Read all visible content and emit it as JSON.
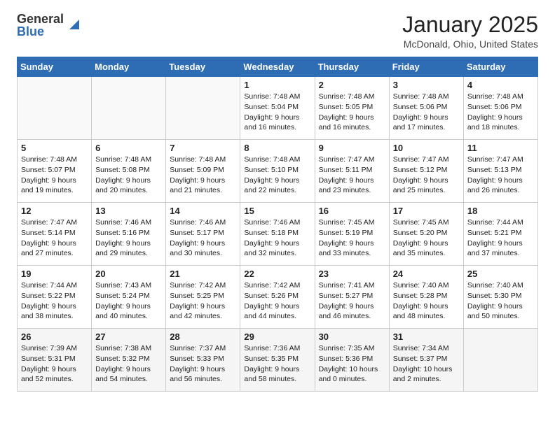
{
  "header": {
    "logo_general": "General",
    "logo_blue": "Blue",
    "month_title": "January 2025",
    "location": "McDonald, Ohio, United States"
  },
  "calendar": {
    "days_of_week": [
      "Sunday",
      "Monday",
      "Tuesday",
      "Wednesday",
      "Thursday",
      "Friday",
      "Saturday"
    ],
    "weeks": [
      [
        {
          "day": "",
          "info": ""
        },
        {
          "day": "",
          "info": ""
        },
        {
          "day": "",
          "info": ""
        },
        {
          "day": "1",
          "info": "Sunrise: 7:48 AM\nSunset: 5:04 PM\nDaylight: 9 hours\nand 16 minutes."
        },
        {
          "day": "2",
          "info": "Sunrise: 7:48 AM\nSunset: 5:05 PM\nDaylight: 9 hours\nand 16 minutes."
        },
        {
          "day": "3",
          "info": "Sunrise: 7:48 AM\nSunset: 5:06 PM\nDaylight: 9 hours\nand 17 minutes."
        },
        {
          "day": "4",
          "info": "Sunrise: 7:48 AM\nSunset: 5:06 PM\nDaylight: 9 hours\nand 18 minutes."
        }
      ],
      [
        {
          "day": "5",
          "info": "Sunrise: 7:48 AM\nSunset: 5:07 PM\nDaylight: 9 hours\nand 19 minutes."
        },
        {
          "day": "6",
          "info": "Sunrise: 7:48 AM\nSunset: 5:08 PM\nDaylight: 9 hours\nand 20 minutes."
        },
        {
          "day": "7",
          "info": "Sunrise: 7:48 AM\nSunset: 5:09 PM\nDaylight: 9 hours\nand 21 minutes."
        },
        {
          "day": "8",
          "info": "Sunrise: 7:48 AM\nSunset: 5:10 PM\nDaylight: 9 hours\nand 22 minutes."
        },
        {
          "day": "9",
          "info": "Sunrise: 7:47 AM\nSunset: 5:11 PM\nDaylight: 9 hours\nand 23 minutes."
        },
        {
          "day": "10",
          "info": "Sunrise: 7:47 AM\nSunset: 5:12 PM\nDaylight: 9 hours\nand 25 minutes."
        },
        {
          "day": "11",
          "info": "Sunrise: 7:47 AM\nSunset: 5:13 PM\nDaylight: 9 hours\nand 26 minutes."
        }
      ],
      [
        {
          "day": "12",
          "info": "Sunrise: 7:47 AM\nSunset: 5:14 PM\nDaylight: 9 hours\nand 27 minutes."
        },
        {
          "day": "13",
          "info": "Sunrise: 7:46 AM\nSunset: 5:16 PM\nDaylight: 9 hours\nand 29 minutes."
        },
        {
          "day": "14",
          "info": "Sunrise: 7:46 AM\nSunset: 5:17 PM\nDaylight: 9 hours\nand 30 minutes."
        },
        {
          "day": "15",
          "info": "Sunrise: 7:46 AM\nSunset: 5:18 PM\nDaylight: 9 hours\nand 32 minutes."
        },
        {
          "day": "16",
          "info": "Sunrise: 7:45 AM\nSunset: 5:19 PM\nDaylight: 9 hours\nand 33 minutes."
        },
        {
          "day": "17",
          "info": "Sunrise: 7:45 AM\nSunset: 5:20 PM\nDaylight: 9 hours\nand 35 minutes."
        },
        {
          "day": "18",
          "info": "Sunrise: 7:44 AM\nSunset: 5:21 PM\nDaylight: 9 hours\nand 37 minutes."
        }
      ],
      [
        {
          "day": "19",
          "info": "Sunrise: 7:44 AM\nSunset: 5:22 PM\nDaylight: 9 hours\nand 38 minutes."
        },
        {
          "day": "20",
          "info": "Sunrise: 7:43 AM\nSunset: 5:24 PM\nDaylight: 9 hours\nand 40 minutes."
        },
        {
          "day": "21",
          "info": "Sunrise: 7:42 AM\nSunset: 5:25 PM\nDaylight: 9 hours\nand 42 minutes."
        },
        {
          "day": "22",
          "info": "Sunrise: 7:42 AM\nSunset: 5:26 PM\nDaylight: 9 hours\nand 44 minutes."
        },
        {
          "day": "23",
          "info": "Sunrise: 7:41 AM\nSunset: 5:27 PM\nDaylight: 9 hours\nand 46 minutes."
        },
        {
          "day": "24",
          "info": "Sunrise: 7:40 AM\nSunset: 5:28 PM\nDaylight: 9 hours\nand 48 minutes."
        },
        {
          "day": "25",
          "info": "Sunrise: 7:40 AM\nSunset: 5:30 PM\nDaylight: 9 hours\nand 50 minutes."
        }
      ],
      [
        {
          "day": "26",
          "info": "Sunrise: 7:39 AM\nSunset: 5:31 PM\nDaylight: 9 hours\nand 52 minutes."
        },
        {
          "day": "27",
          "info": "Sunrise: 7:38 AM\nSunset: 5:32 PM\nDaylight: 9 hours\nand 54 minutes."
        },
        {
          "day": "28",
          "info": "Sunrise: 7:37 AM\nSunset: 5:33 PM\nDaylight: 9 hours\nand 56 minutes."
        },
        {
          "day": "29",
          "info": "Sunrise: 7:36 AM\nSunset: 5:35 PM\nDaylight: 9 hours\nand 58 minutes."
        },
        {
          "day": "30",
          "info": "Sunrise: 7:35 AM\nSunset: 5:36 PM\nDaylight: 10 hours\nand 0 minutes."
        },
        {
          "day": "31",
          "info": "Sunrise: 7:34 AM\nSunset: 5:37 PM\nDaylight: 10 hours\nand 2 minutes."
        },
        {
          "day": "",
          "info": ""
        }
      ]
    ]
  }
}
